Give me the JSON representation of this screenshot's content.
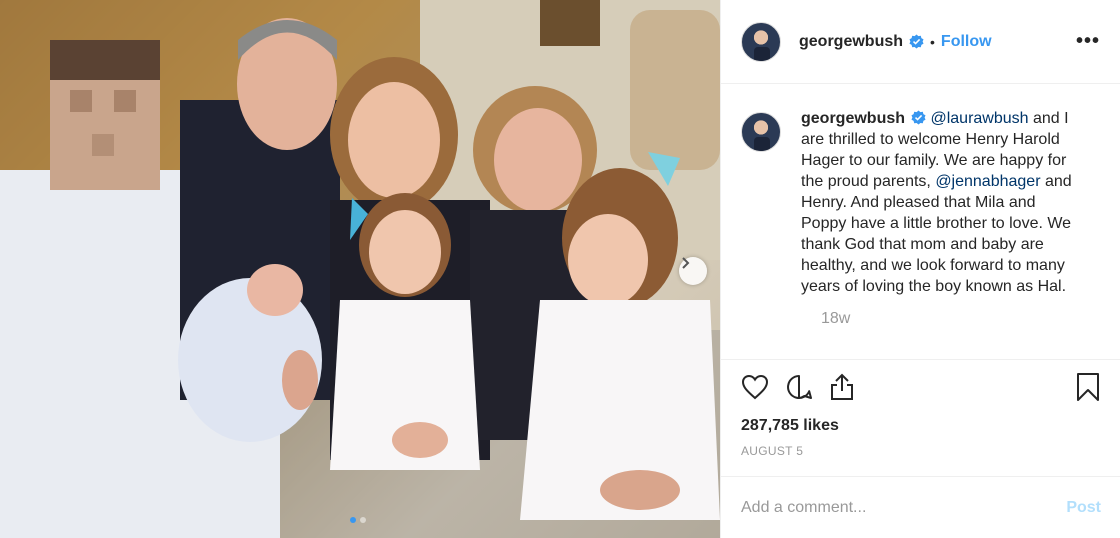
{
  "post": {
    "username": "georgewbush",
    "separator": "•",
    "follow_label": "Follow",
    "more_label": "•••",
    "caption_parts": [
      {
        "type": "text",
        "value": " "
      },
      {
        "type": "mention",
        "value": "@laurawbush"
      },
      {
        "type": "text",
        "value": " and I are thrilled to welcome Henry Harold Hager to our family. We are happy for the proud parents, "
      },
      {
        "type": "mention",
        "value": "@jennabhager"
      },
      {
        "type": "text",
        "value": " and Henry. And pleased that Mila and Poppy have a little brother to love. We thank God that mom and baby are healthy, and we look forward to many years of loving the boy known as Hal."
      }
    ],
    "timestamp": "18w",
    "likes": "287,785 likes",
    "date": "AUGUST 5"
  },
  "comment": {
    "placeholder": "Add a comment...",
    "post_label": "Post"
  },
  "icons": {
    "verified": "verified-badge-icon",
    "like": "heart-icon",
    "comment": "comment-bubble-icon",
    "share": "share-icon",
    "save": "bookmark-icon",
    "next": "chevron-right-icon"
  },
  "colors": {
    "accent": "#3897f0",
    "mention": "#003569",
    "muted": "#999999",
    "post_disabled": "#b2dffc"
  },
  "carousel": {
    "count": 2,
    "active": 0
  }
}
